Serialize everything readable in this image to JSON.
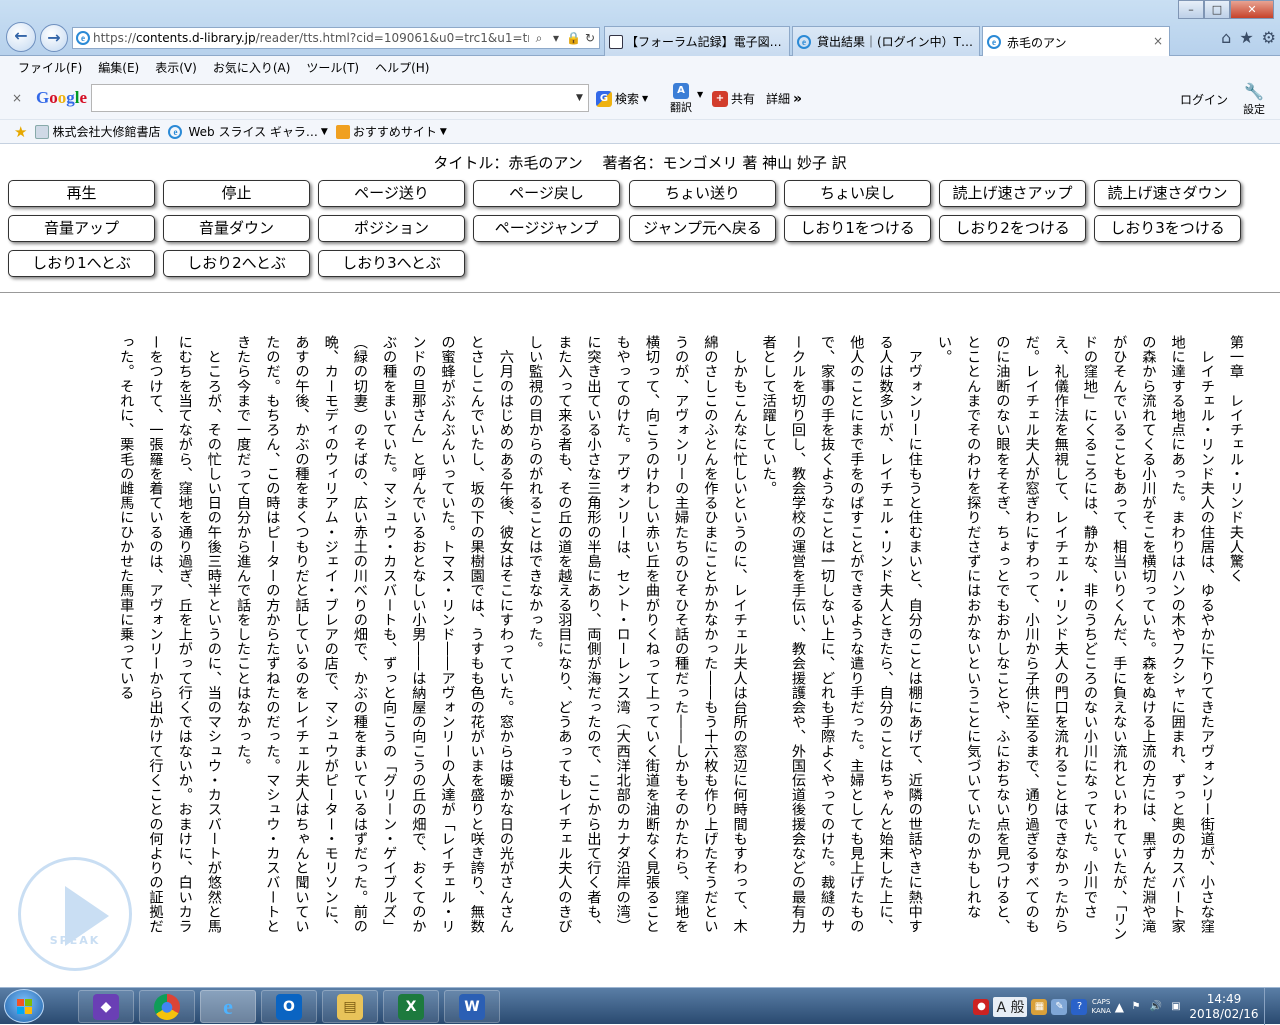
{
  "browser": {
    "url_prefix": "https://",
    "url_host": "contents.d-library.jp",
    "url_path": "/reader/tts.html?cid=109061&u0=trc1&u1=tr",
    "tabs": [
      {
        "label": "【フォーラム記録】電子図…"
      },
      {
        "label": "貸出結果｜(ログイン中）T…"
      },
      {
        "label": "赤毛のアン"
      }
    ],
    "tab_close": "×",
    "window_controls": {
      "minimize": "–",
      "maximize": "□",
      "close": "✕"
    },
    "icons": {
      "home": "⌂",
      "favorites": "★",
      "tools": "⚙"
    }
  },
  "menu": [
    "ファイル(F)",
    "編集(E)",
    "表示(V)",
    "お気に入り(A)",
    "ツール(T)",
    "ヘルプ(H)"
  ],
  "google_toolbar": {
    "close": "×",
    "logo": [
      "G",
      "o",
      "o",
      "g",
      "l",
      "e"
    ],
    "search_label": "検索",
    "translate_label": "翻訳",
    "share_label": "共有",
    "more_label": "詳細",
    "more_arrow": "»",
    "login_label": "ログイン",
    "settings_label": "設定"
  },
  "favorites_bar": [
    {
      "label": "株式会社大修館書店"
    },
    {
      "label": "Web スライス ギャラ…"
    },
    {
      "label": "おすすめサイト"
    }
  ],
  "reader": {
    "book_title": "タイトル：赤毛のアン　 著者名：モンゴメリ 著 神山 妙子 訳",
    "controls": [
      "再生",
      "停止",
      "ページ送り",
      "ページ戻し",
      "ちょい送り",
      "ちょい戻し",
      "読上げ速さアップ",
      "読上げ速さダウン",
      "音量アップ",
      "音量ダウン",
      "ポジション",
      "ページジャンプ",
      "ジャンプ元へ戻る",
      "しおり1をつける",
      "しおり2をつける",
      "しおり3をつける",
      "しおり1へとぶ",
      "しおり2へとぶ",
      "しおり3へとぶ"
    ],
    "text": "第一章　レイチェル・リンド夫人驚く\n　レイチェル・リンド夫人の住居は、ゆるやかに下りてきたアヴォンリー街道が、小さな窪地に達する地点にあった。まわりはハンの木やフクシャに囲まれ、ずっと奥のカスバート家の森から流れてくる小川がそこを横切っていた。森をぬける上流の方には、黒ずんだ淵や滝がひそんでいることもあって、相当いりくんだ、手に負えない流れといわれていたが、「リンドの窪地」にくるころには、静かな、非のうちどころのない小川になっていた。小川でさえ、礼儀作法を無視して、レイチェル・リンド夫人の門口を流れることはできなかったからだ。レイチェル夫人が窓ぎわにすわって、小川から子供に至るまで、通り過ぎるすべてのものに油断のない眼をそそぎ、ちょっとでもおかしなことや、ふにおちない点を見つけると、とことんまでそのわけを探りださずにはおかないということに気づいていたのかもしれない。\n　アヴォンリーに住もうと住むまいと、自分のことは棚にあげて、近隣の世話やきに熱中する人は数多いが、レイチェル・リンド夫人ときたら、自分のことはちゃんと始末した上に、他人のことにまで手をのばすことができるような遣り手だった。主婦としても見上げたもので、家事の手を抜くようなことは一切しない上に、どれも手際よくやってのけた。裁縫のサークルを切り回し、教会学校の運営を手伝い、教会援護会や、外国伝道後援会などの最有力者として活躍していた。\n　しかもこんなに忙しいというのに、レイチェル夫人は台所の窓辺に何時間もすわって、木綿のさしこのふとんを作るひまにことかかなかった――もう十六枚も作り上げたそうだというのが、アヴォンリーの主婦たちのひそひそ話の種だった――しかもそのかたわら、窪地を横切って、向こうのけわしい赤い丘を曲がりくねって上っていく街道を油断なく見張ることもやってのけた。アヴォンリーは、セント・ローレンス湾（大西洋北部のカナダ沿岸の湾）に突き出ている小さな三角形の半島にあり、両側が海だったので、ここから出て行く者も、また入って来る者も、その丘の道を越える羽目になり、どうあってもレイチェル夫人のきびしい監視の目からのがれることはできなかった。\n　六月のはじめのある午後、彼女はそこにすわっていた。窓からは暖かな日の光がさんさんとさしこんでいたし、坂の下の果樹園では、うすもも色の花がいまを盛りと咲き誇り、無数の蜜蜂がぶんぶんいっていた。トマス・リンド――アヴォンリーの人達が「レイチェル・リンドの旦那さん」と呼んでいるおとなしい小男――は納屋の向こうの丘の畑で、おくてのかぶの種をまいていた。マシュウ・カスバートも、ずっと向こうの「グリーン・ゲイブルズ」（緑の切妻）のそばの、広い赤土の川べりの畑で、かぶの種をまいているはずだった。前の晩、カーモディのウィリアム・ジェイ・ブレアの店で、マシュウがピーター・モリソンに、あすの午後、かぶの種をまくつもりだと話しているのをレイチェル夫人はちゃんと聞いていたのだ。もちろん、この時はピーターの方からたずねたのだった。マシュウ・カスバートときたら今まで一度だって自分から進んで話をしたことはなかった。\n　ところが、その忙しい日の午後三時半というのに、当のマシュウ・カスバートが悠然と馬にむちを当てながら、窪地を通り過ぎ、丘を上がって行くではないか。おまけに、白いカラーをつけて、一張羅を着ているのは、アヴォンリーから出かけて行くことの何よりの証拠だった。それに、栗毛の雌馬にひかせた馬車に乗っている",
    "speak_logo_text": "SPEAK"
  },
  "taskbar": {
    "clock_time": "14:49",
    "clock_date": "2018/02/16",
    "ime_label": "A 般",
    "caps_label": "CAPS",
    "kana_label": "KANA",
    "apps": [
      {
        "name": "visual-studio",
        "glyph": "◆"
      },
      {
        "name": "chrome",
        "glyph": "●"
      },
      {
        "name": "internet-explorer",
        "glyph": "e"
      },
      {
        "name": "outlook",
        "glyph": "O"
      },
      {
        "name": "explorer",
        "glyph": "▤"
      },
      {
        "name": "excel",
        "glyph": "X"
      },
      {
        "name": "word",
        "glyph": "W"
      }
    ]
  }
}
